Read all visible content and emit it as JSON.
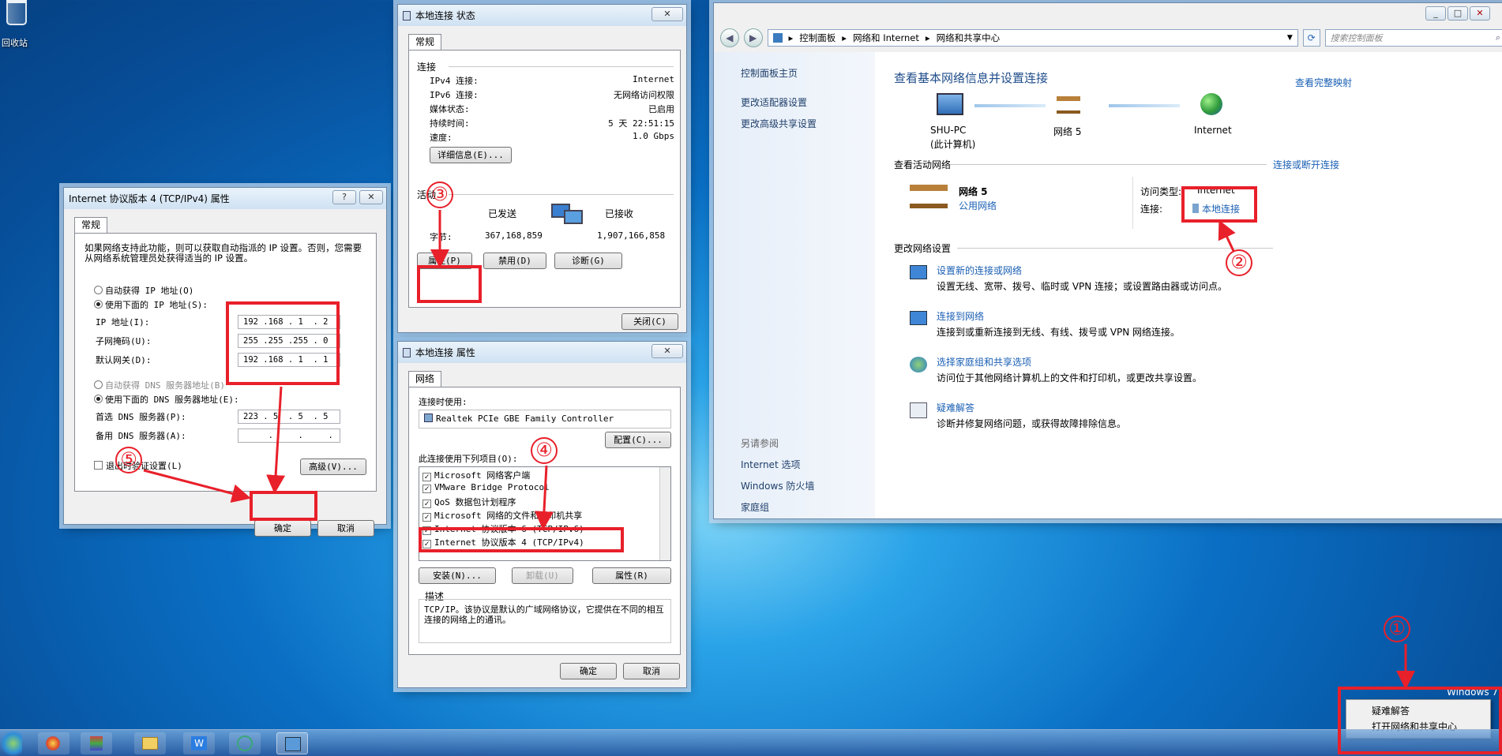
{
  "desktop": {
    "recycle_bin": "回收站",
    "windows_brand": "Windows 7"
  },
  "tcpip": {
    "title": "Internet 协议版本 4 (TCP/IPv4) 属性",
    "help": "?",
    "close": "✕",
    "tab": "常规",
    "desc": "如果网络支持此功能，则可以获取自动指派的 IP 设置。否则，您需要从网络系统管理员处获得适当的 IP 设置。",
    "auto_ip": "自动获得 IP 地址(O)",
    "manual_ip": "使用下面的 IP 地址(S):",
    "ip_label": "IP 地址(I):",
    "ip_value": "192 .168 . 1  . 2",
    "mask_label": "子网掩码(U):",
    "mask_value": "255 .255 .255 . 0",
    "gw_label": "默认网关(D):",
    "gw_value": "192 .168 . 1  . 1",
    "auto_dns": "自动获得 DNS 服务器地址(B)",
    "manual_dns": "使用下面的 DNS 服务器地址(E):",
    "dns1_label": "首选 DNS 服务器(P):",
    "dns1_value": "223 . 5  . 5  . 5",
    "dns2_label": "备用 DNS 服务器(A):",
    "dns2_value": "     .     .     .",
    "validate": "退出时验证设置(L)",
    "advanced": "高级(V)...",
    "ok": "确定",
    "cancel": "取消"
  },
  "status": {
    "title": "本地连接 状态",
    "close": "✕",
    "tab": "常规",
    "conn_group": "连接",
    "rows": [
      {
        "k": "IPv4 连接:",
        "v": "Internet"
      },
      {
        "k": "IPv6 连接:",
        "v": "无网络访问权限"
      },
      {
        "k": "媒体状态:",
        "v": "已启用"
      },
      {
        "k": "持续时间:",
        "v": "5 天 22:51:15"
      },
      {
        "k": "速度:",
        "v": "1.0 Gbps"
      }
    ],
    "details": "详细信息(E)...",
    "activity_group": "活动",
    "sent": "已发送",
    "received": "已接收",
    "bytes_label": "字节:",
    "bytes_sent": "367,168,859",
    "bytes_recv": "1,907,166,858",
    "properties": "属性(P)",
    "disable": "禁用(D)",
    "diagnose": "诊断(G)",
    "close_btn": "关闭(C)"
  },
  "props": {
    "title": "本地连接 属性",
    "close": "✕",
    "tab": "网络",
    "connect_using": "连接时使用:",
    "adapter": "Realtek PCIe GBE Family Controller",
    "configure": "配置(C)...",
    "items_label": "此连接使用下列项目(O):",
    "items": [
      "Microsoft 网络客户端",
      "VMware Bridge Protocol",
      "QoS 数据包计划程序",
      "Microsoft 网络的文件和打印机共享",
      "Internet 协议版本 6 (TCP/IPv6)",
      "Internet 协议版本 4 (TCP/IPv4)"
    ],
    "install": "安装(N)...",
    "uninstall": "卸载(U)",
    "properties": "属性(R)",
    "desc_group": "描述",
    "desc": "TCP/IP。该协议是默认的广域网络协议，它提供在不同的相互连接的网络上的通讯。",
    "ok": "确定",
    "cancel": "取消"
  },
  "netcenter": {
    "breadcrumb": [
      "控制面板",
      "网络和 Internet",
      "网络和共享中心"
    ],
    "search_placeholder": "搜索控制面板",
    "left_links": [
      "控制面板主页",
      "更改适配器设置",
      "更改高级共享设置"
    ],
    "see_also": "另请参阅",
    "see_also_links": [
      "Internet 选项",
      "Windows 防火墙",
      "家庭组"
    ],
    "heading": "查看基本网络信息并设置连接",
    "full_map": "查看完整映射",
    "map_pc": "SHU-PC",
    "map_pc_sub": "(此计算机)",
    "map_net": "网络 5",
    "map_inet": "Internet",
    "active_label": "查看活动网络",
    "connect_disconnect": "连接或断开连接",
    "net_name": "网络 5",
    "net_type": "公用网络",
    "access_label": "访问类型:",
    "access_value": "Internet",
    "conn_label": "连接:",
    "conn_value": "本地连接",
    "change_label": "更改网络设置",
    "tasks": [
      {
        "title": "设置新的连接或网络",
        "desc": "设置无线、宽带、拨号、临时或 VPN 连接；或设置路由器或访问点。"
      },
      {
        "title": "连接到网络",
        "desc": "连接到或重新连接到无线、有线、拨号或 VPN 网络连接。"
      },
      {
        "title": "选择家庭组和共享选项",
        "desc": "访问位于其他网络计算机上的文件和打印机，或更改共享设置。"
      },
      {
        "title": "疑难解答",
        "desc": "诊断并修复网络问题，或获得故障排除信息。"
      }
    ]
  },
  "tray_menu": [
    "疑难解答",
    "打开网络和共享中心"
  ],
  "markers": [
    "①",
    "②",
    "③",
    "④",
    "⑤"
  ]
}
